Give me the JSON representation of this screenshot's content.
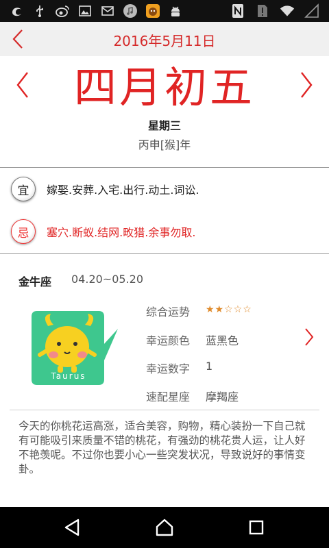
{
  "status_bar": {
    "left_icons": [
      "uc-browser-icon",
      "usb-icon",
      "weibo-icon",
      "image-icon",
      "mail-icon",
      "music-icon",
      "cat-app-icon",
      "android-icon"
    ],
    "right_icons": [
      "nfc-icon",
      "sim-icon",
      "wifi-icon",
      "signal-icon"
    ]
  },
  "header": {
    "date": "2016年5月11日"
  },
  "lunar": {
    "date": "四月初五",
    "weekday": "星期三",
    "ganzhi": "丙申[猴]年"
  },
  "yiji": {
    "yi_label": "宜",
    "yi_text": "嫁娶.安葬.入宅.出行.动土.词讼.",
    "ji_label": "忌",
    "ji_text": "塞穴.断蚁.结网.畋猎.余事勿取."
  },
  "horoscope": {
    "sign": "金牛座",
    "range": "04.20~05.20",
    "avatar_text": "Taurus",
    "fields": {
      "overall_label": "综合运势",
      "overall_stars": "★★☆☆☆",
      "overall_rating": 2,
      "color_label": "幸运颜色",
      "color_value": "蓝黑色",
      "number_label": "幸运数字",
      "number_value": "1",
      "match_label": "速配星座",
      "match_value": "摩羯座"
    },
    "description": "今天的你桃花运高涨，适合美容，购物，精心装扮一下自己就有可能吸引来质量不错的桃花，有强劲的桃花贵人运，让人好不艳羡呢。不过你也要小心一些突发状况，导致说好的事情变卦。"
  },
  "colors": {
    "accent_red": "#e02424",
    "avatar_green": "#3ec78e",
    "star_orange": "#e08a2a"
  }
}
